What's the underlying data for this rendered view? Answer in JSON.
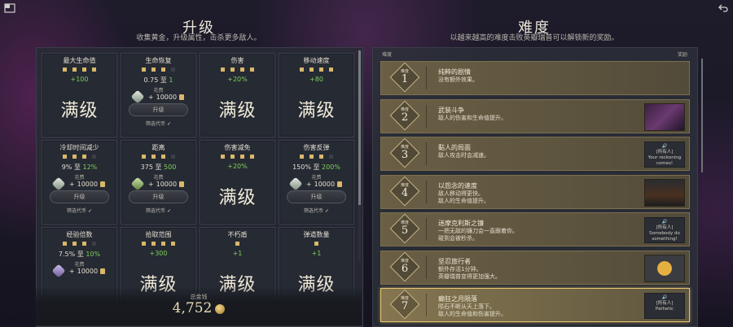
{
  "top_bar": {
    "left_icon": "window-icon",
    "right_icon": "back-arrow-icon"
  },
  "upgrade": {
    "title": "升级",
    "subtitle": "收集黄金，升级属性，击杀更多敌人。",
    "cards": [
      {
        "name": "最大生命值",
        "pips": [
          1,
          1,
          1,
          1
        ],
        "value": "+100",
        "max_label": "满级",
        "state": "max"
      },
      {
        "name": "生命恢复",
        "pips": [
          1,
          1,
          1,
          0
        ],
        "value_parts": [
          "0.75",
          "至",
          "1"
        ],
        "cost_label": "花费",
        "cost": "10000",
        "gem": "white",
        "button": "升级",
        "filter": "筛选代币",
        "state": "upgrade"
      },
      {
        "name": "伤害",
        "pips": [
          1,
          1,
          1,
          1
        ],
        "value": "+20%",
        "max_label": "满级",
        "state": "max"
      },
      {
        "name": "移动速度",
        "pips": [
          1,
          1,
          1,
          1
        ],
        "value": "+80",
        "max_label": "满级",
        "state": "max"
      },
      {
        "name": "冷却时间减少",
        "pips": [
          1,
          1,
          1,
          0
        ],
        "value_parts": [
          "9%",
          "至",
          "12%"
        ],
        "cost_label": "花费",
        "cost": "10000",
        "gem": "white",
        "button": "升级",
        "filter": "筛选代币",
        "state": "upgrade"
      },
      {
        "name": "距离",
        "pips": [
          1,
          1,
          1,
          0
        ],
        "value_parts": [
          "375",
          "至",
          "500"
        ],
        "cost_label": "花费",
        "cost": "10000",
        "gem": "green",
        "button": "升级",
        "filter": "筛选代币",
        "state": "upgrade"
      },
      {
        "name": "伤害减免",
        "pips": [
          1,
          1,
          1,
          1
        ],
        "value": "+20%",
        "max_label": "满级",
        "state": "max"
      },
      {
        "name": "伤害反弹",
        "pips": [
          1,
          1,
          1,
          0
        ],
        "value_parts": [
          "150%",
          "至",
          "200%"
        ],
        "cost_label": "花费",
        "cost": "10000",
        "gem": "white",
        "button": "升级",
        "filter": "筛选代币",
        "state": "upgrade"
      },
      {
        "name": "经验倍数",
        "pips": [
          1,
          1,
          1,
          0
        ],
        "value_parts": [
          "7.5%",
          "至",
          "10%"
        ],
        "cost_label": "花费",
        "cost": "10000",
        "gem": "purple",
        "state": "partial"
      },
      {
        "name": "拾取范围",
        "pips": [
          1,
          1,
          1,
          1
        ],
        "value": "+300",
        "max_label": "满级",
        "state": "max"
      },
      {
        "name": "不朽盾",
        "pips": [
          1
        ],
        "value": "+1",
        "max_label": "满级",
        "state": "max"
      },
      {
        "name": "弹道数量",
        "pips": [
          1
        ],
        "value": "+1",
        "max_label": "满级",
        "state": "max"
      }
    ],
    "gold_label": "总金钱",
    "gold_amount": "4,752"
  },
  "difficulty": {
    "title": "难度",
    "subtitle": "以越来越高的难度击败英瓣瑞普可以解锁新的奖励。",
    "col_left": "难度",
    "col_right": "奖励",
    "badge_label": "难度",
    "levels": [
      {
        "num": "1",
        "name": "纯粹的剧情",
        "desc": [
          "没有额外效果。"
        ],
        "reward": "none"
      },
      {
        "num": "2",
        "name": "武装斗争",
        "desc": [
          "敌人的伤害和生命值提升。"
        ],
        "reward": "image",
        "reward_icon": "hero-portrait-icon"
      },
      {
        "num": "3",
        "name": "黏人的局面",
        "desc": [
          "敌人攻击时会减速。"
        ],
        "reward": "voice",
        "voice_lines": [
          "[所有人]",
          "Your reckoning",
          "comes!"
        ]
      },
      {
        "num": "4",
        "name": "以怨念的速度",
        "desc": [
          "敌人移动得更快。",
          "敌人的生命值提升。"
        ],
        "reward": "image",
        "reward_icon": "hero-figure-icon"
      },
      {
        "num": "5",
        "name": "迷摩克利斯之镰",
        "desc": [
          "一把无敌的镰刀会一直跟着你。",
          "碰到会被秒杀。"
        ],
        "reward": "voice",
        "voice_lines": [
          "[所有人]",
          "Somebody do",
          "something!"
        ]
      },
      {
        "num": "6",
        "name": "坚忍旅行者",
        "desc": [
          "额外存活1分钟。",
          "英瓣瑞普变得更加强大。"
        ],
        "reward": "image",
        "reward_icon": "duck-emblem-icon"
      },
      {
        "num": "7",
        "name": "癫狂之月陨落",
        "desc": [
          "陨石不断从天上落下。",
          "敌人的生命值和伤害提升。"
        ],
        "reward": "voice",
        "voice_lines": [
          "[所有人]",
          "Pathetic"
        ],
        "selected": true
      }
    ]
  }
}
